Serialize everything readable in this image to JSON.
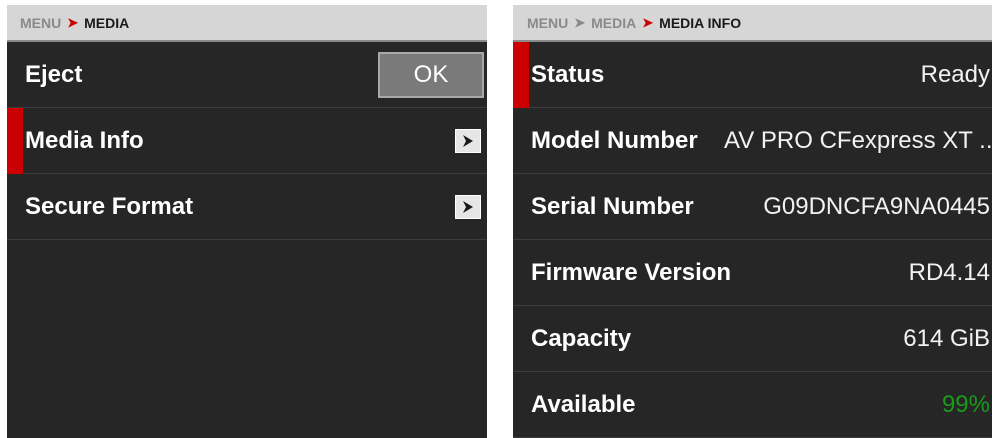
{
  "left": {
    "breadcrumb": {
      "root": "MENU",
      "current": "MEDIA"
    },
    "items": [
      {
        "label": "Eject",
        "button": "OK"
      },
      {
        "label": "Media Info"
      },
      {
        "label": "Secure Format"
      }
    ],
    "selected_item": "Media Info"
  },
  "right": {
    "breadcrumb": {
      "root": "MENU",
      "middle": "MEDIA",
      "current": "MEDIA INFO"
    },
    "rows": [
      {
        "label": "Status",
        "value": "Ready"
      },
      {
        "label": "Model Number",
        "value": "AV PRO CFexpress XT ..."
      },
      {
        "label": "Serial Number",
        "value": "G09DNCFA9NA0445"
      },
      {
        "label": "Firmware Version",
        "value": "RD4.14"
      },
      {
        "label": "Capacity",
        "value": "614 GiB"
      },
      {
        "label": "Available",
        "value": "99%"
      }
    ],
    "selected_row": "Status"
  },
  "icons": {
    "breadcrumb_separator": "chevron-right-icon",
    "submenu_arrow": "arrow-right-icon"
  },
  "colors": {
    "accent_red": "#cc0000",
    "available_green": "#1a9a1a",
    "panel_bg": "#262626",
    "breadcrumb_bg": "#d6d6d6"
  }
}
